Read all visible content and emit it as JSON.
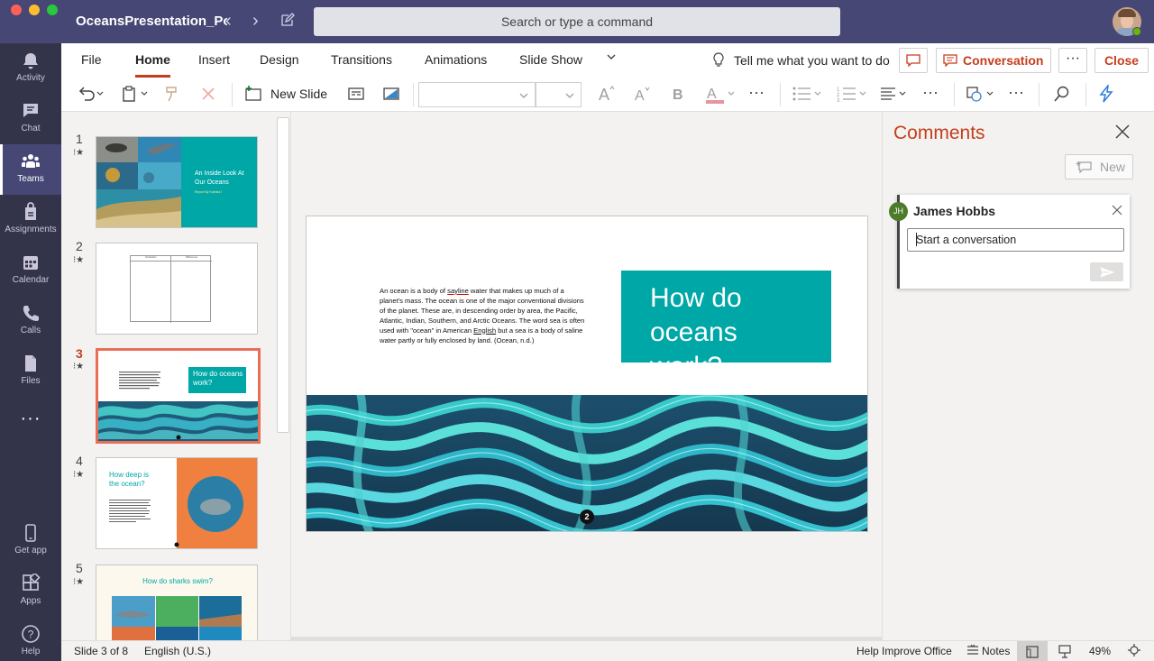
{
  "titlebar": {
    "doc_title": "OceansPresentation_Po...",
    "search_placeholder": "Search or type a command"
  },
  "rail": [
    {
      "label": "Activity",
      "icon": "bell-icon"
    },
    {
      "label": "Chat",
      "icon": "chat-icon"
    },
    {
      "label": "Teams",
      "icon": "teams-icon"
    },
    {
      "label": "Assignments",
      "icon": "assignments-icon"
    },
    {
      "label": "Calendar",
      "icon": "calendar-icon"
    },
    {
      "label": "Calls",
      "icon": "phone-icon"
    },
    {
      "label": "Files",
      "icon": "files-icon"
    }
  ],
  "rail_bottom": [
    {
      "label": "Get app",
      "icon": "phone-device-icon"
    },
    {
      "label": "Apps",
      "icon": "apps-icon"
    },
    {
      "label": "Help",
      "icon": "help-icon"
    }
  ],
  "menu": {
    "tabs": [
      "File",
      "Home",
      "Insert",
      "Design",
      "Transitions",
      "Animations",
      "Slide Show"
    ],
    "active_tab": "Home",
    "tell_me": "Tell me what you want to do",
    "conversation": "Conversation",
    "close": "Close",
    "more": "···"
  },
  "toolbar": {
    "new_slide": "New Slide",
    "font_name": "",
    "font_size": ""
  },
  "thumbnails": [
    {
      "number": "1",
      "title": "An Inside Look At Our Oceans",
      "subtitle": "Report By Katinka I"
    },
    {
      "number": "2",
      "col1": "Similarities",
      "col2": "Differences"
    },
    {
      "number": "3",
      "title": "How do oceans work?"
    },
    {
      "number": "4",
      "title": "How deep is the ocean?"
    },
    {
      "number": "5",
      "title": "How do sharks swim?"
    }
  ],
  "active_slide": 3,
  "slide": {
    "body_parts": [
      "An ocean is a body of ",
      "sayline",
      " water that makes up much of a planet's mass. The ocean is one of the major conventional divisions of the planet. These are, in descending order by area, the Pacific, Atlantic, Indian, Southern, and Arctic Oceans. The word sea is often used with \"ocean\" in American ",
      "English",
      " but a sea is a body of saline water partly or fully enclosed by land. (Ocean, n.d.)"
    ],
    "title": "How do oceans work?",
    "marker": "2",
    "accent": "#00a7a7"
  },
  "comments": {
    "title": "Comments",
    "new_label": "New",
    "card": {
      "initials": "JH",
      "name": "James Hobbs",
      "placeholder": "Start a conversation"
    }
  },
  "status": {
    "slide_info": "Slide 3 of 8",
    "language": "English (U.S.)",
    "help_improve": "Help Improve Office",
    "notes": "Notes",
    "zoom": "49%"
  },
  "colors": {
    "teams_purple": "#464775",
    "rail": "#33344a",
    "accent_red": "#c43e1c"
  }
}
